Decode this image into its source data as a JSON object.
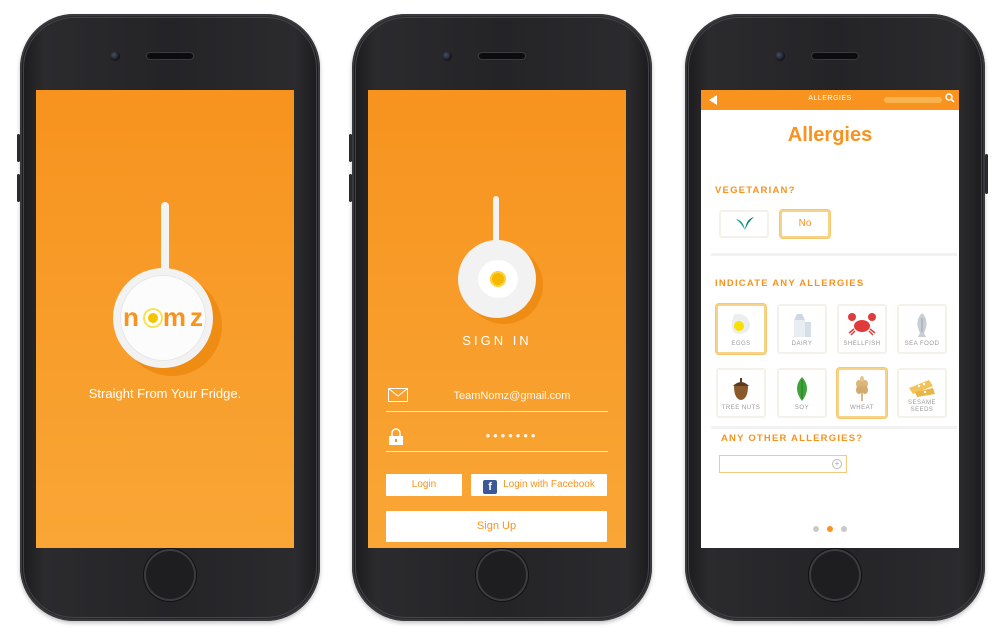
{
  "splash": {
    "logo": "nmz",
    "logo_parts": [
      "n",
      "mz"
    ],
    "tagline": "Straight From Your Fridge."
  },
  "signin": {
    "title": "SIGN IN",
    "email_value": "TeamNomz@gmail.com",
    "password_value": "•••••••",
    "login_label": "Login",
    "facebook_label": "Login with Facebook",
    "signup_label": "Sign Up"
  },
  "allergies": {
    "topbar_title": "ALLERGIES",
    "title": "Allergies",
    "vegetarian_label": "VEGETARIAN?",
    "vegetarian_no": "No",
    "allergies_label": "INDICATE ANY ALLERGIES",
    "items": [
      {
        "label": "EGGS",
        "icon": "egg-icon",
        "selected": true
      },
      {
        "label": "DAIRY",
        "icon": "milk-icon",
        "selected": false
      },
      {
        "label": "SHELLFISH",
        "icon": "crab-icon",
        "selected": false
      },
      {
        "label": "SEA FOOD",
        "icon": "fish-icon",
        "selected": false
      },
      {
        "label": "TREE NUTS",
        "icon": "acorn-icon",
        "selected": false
      },
      {
        "label": "SOY",
        "icon": "soy-leaf-icon",
        "selected": false
      },
      {
        "label": "WHEAT",
        "icon": "wheat-icon",
        "selected": true
      },
      {
        "label": "SESAME SEEDS",
        "icon": "sesame-icon",
        "selected": false
      }
    ],
    "other_label": "ANY OTHER ALLERGIES?",
    "page_dots": 3,
    "active_dot": 2
  },
  "colors": {
    "accent": "#f7931e",
    "facebook": "#3b5998"
  }
}
